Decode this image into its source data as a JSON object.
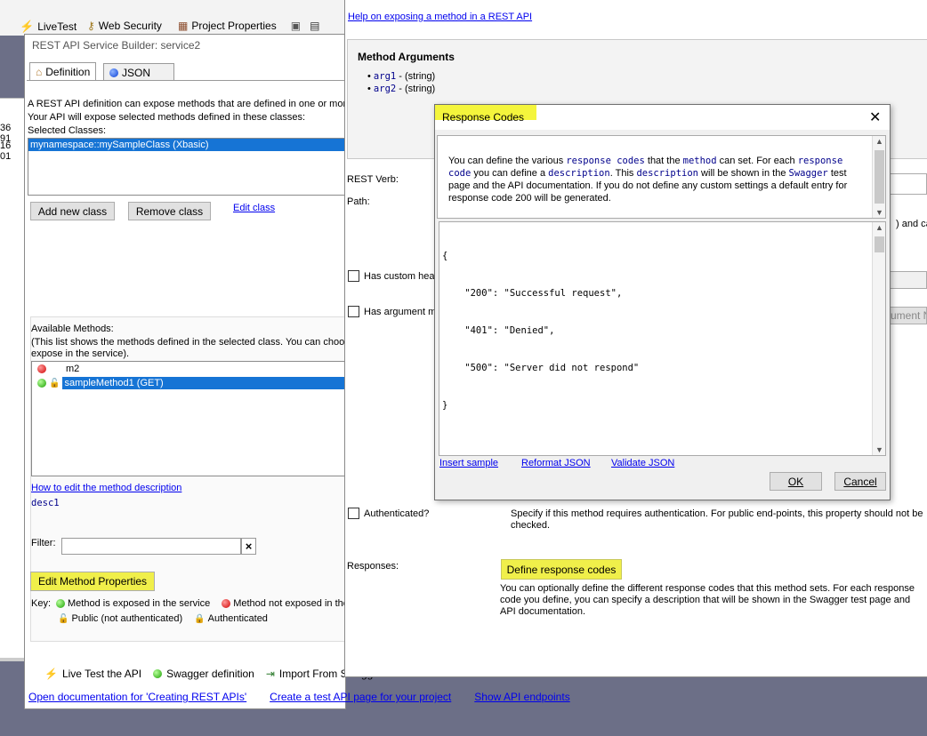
{
  "toolbar": {
    "livetest": "LiveTest",
    "websecurity": "Web Security",
    "projectprops": "Project Properties"
  },
  "left_numbers": [
    "36 91",
    "16 01"
  ],
  "builder": {
    "title": "REST API Service Builder: service2",
    "tabs": [
      "Definition",
      "JSON"
    ],
    "intro_line1": "A REST API definition can expose methods that are defined in one or more",
    "intro_line2": "Your API will expose selected methods defined in these classes:",
    "selected_classes_label": "Selected Classes:",
    "selected_class": "mynamespace::mySampleClass (Xbasic)",
    "add_class": "Add new class",
    "remove_class": "Remove class",
    "edit_class": "Edit class",
    "available_label": "Available Methods:",
    "available_note1": "(This list shows the methods defined in the selected class. You can choose",
    "available_note2": "expose in the service).",
    "methods": [
      "m2",
      "sampleMethod1 (GET)"
    ],
    "how_to_edit": "How to edit the method description",
    "desc": "desc1",
    "filter_label": "Filter:",
    "filter_value": "",
    "clear_icon": "×",
    "edit_method_props": "Edit Method Properties",
    "key_label": "Key:",
    "key_exposed": "Method is exposed in the service",
    "key_not_exposed": "Method not exposed in the",
    "key_public": "Public (not authenticated)",
    "key_auth": "Authenticated",
    "footer_livetest": "Live Test the API",
    "footer_swagger": "Swagger definition",
    "footer_import": "Import From Swagg",
    "footer_link1": "Open documentation for 'Creating REST APIs'",
    "footer_link2": "Create a test API page for your project",
    "footer_link3": "Show API endpoints"
  },
  "props": {
    "help_link": "Help on exposing a method in a REST API",
    "method_args_title": "Method Arguments",
    "args": [
      {
        "name": "arg1",
        "type": " - (string)"
      },
      {
        "name": "arg2",
        "type": " - (string)"
      }
    ],
    "rest_verb": "REST Verb:",
    "path": "Path:",
    "path_tail": ") and ca",
    "has_custom_head": "Has custom head",
    "has_argument": "Has argument ma",
    "arg_btn_tail": "ument Na",
    "authenticated": "Authenticated?",
    "auth_desc": "Specify if this method requires authentication. For public end-points, this property should not be checked.",
    "responses": "Responses:",
    "define_btn": "Define response codes",
    "responses_desc": "You can optionally define the different response codes that this method sets. For each response code you define, you can specify a description that will be shown in the Swagger test page and API documentation."
  },
  "dialog": {
    "title": "Response Codes",
    "close_icon": "✕",
    "info": {
      "t1": "You can define the various ",
      "c1": "response codes",
      "t2": " that the ",
      "c2": "method",
      "t3": " can set. For each ",
      "c3": "response code",
      "t4": " you can define a ",
      "c4": "description",
      "t5": ". This ",
      "c5": "description",
      "t6": " will be shown in the ",
      "c6": "Swagger",
      "t7": " test page and the API documentation. If you do not define any custom settings a default entry for response code 200 will be generated."
    },
    "json_lines": [
      "{",
      "    \"200\": \"Successful request\",",
      "    \"401\": \"Denied\",",
      "    \"500\": \"Server did not respond\"",
      "}"
    ],
    "insert_sample": "Insert sample",
    "reformat": "Reformat JSON",
    "validate": "Validate JSON",
    "ok": "OK",
    "cancel": "Cancel"
  }
}
